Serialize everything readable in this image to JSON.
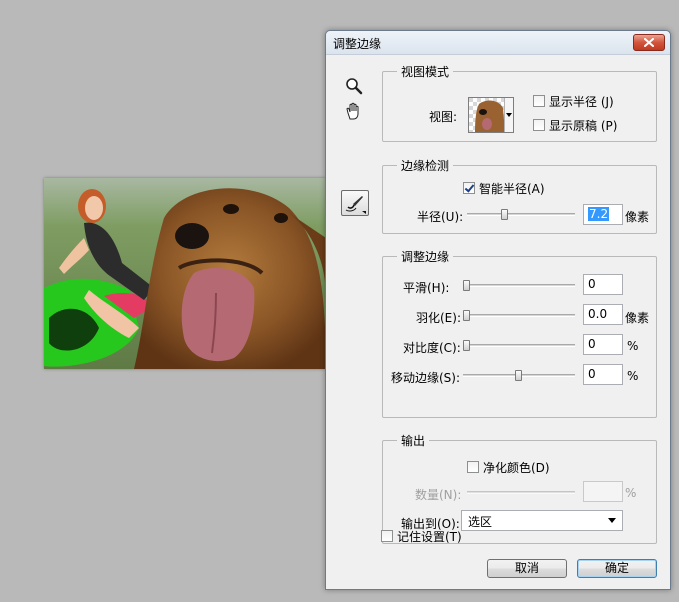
{
  "dialog": {
    "title": "调整边缘",
    "close_icon": "close-icon"
  },
  "tools": {
    "zoom_icon": "magnifier-icon",
    "hand_icon": "hand-icon",
    "refine_brush_icon": "refine-radius-brush-icon"
  },
  "view_mode": {
    "legend": "视图模式",
    "view_label": "视图:",
    "show_radius_label": "显示半径 (J)",
    "show_radius_checked": false,
    "show_original_label": "显示原稿 (P)",
    "show_original_checked": false
  },
  "edge_detection": {
    "legend": "边缘检测",
    "smart_radius_label": "智能半径(A)",
    "smart_radius_checked": true,
    "radius_label": "半径(U):",
    "radius_value": "7.2",
    "radius_unit": "像素"
  },
  "adjust_edge": {
    "legend": "调整边缘",
    "smooth_label": "平滑(H):",
    "smooth_value": "0",
    "feather_label": "羽化(E):",
    "feather_value": "0.0",
    "feather_unit": "像素",
    "contrast_label": "对比度(C):",
    "contrast_value": "0",
    "contrast_unit": "%",
    "shift_label": "移动边缘(S):",
    "shift_value": "0",
    "shift_unit": "%"
  },
  "output": {
    "legend": "输出",
    "decontaminate_label": "净化颜色(D)",
    "decontaminate_checked": false,
    "amount_label": "数量(N):",
    "amount_value": "",
    "amount_unit": "%",
    "output_to_label": "输出到(O):",
    "output_to_value": "选区"
  },
  "remember_settings_label": "记住设置(T)",
  "remember_settings_checked": false,
  "buttons": {
    "cancel": "取消",
    "ok": "确定"
  }
}
